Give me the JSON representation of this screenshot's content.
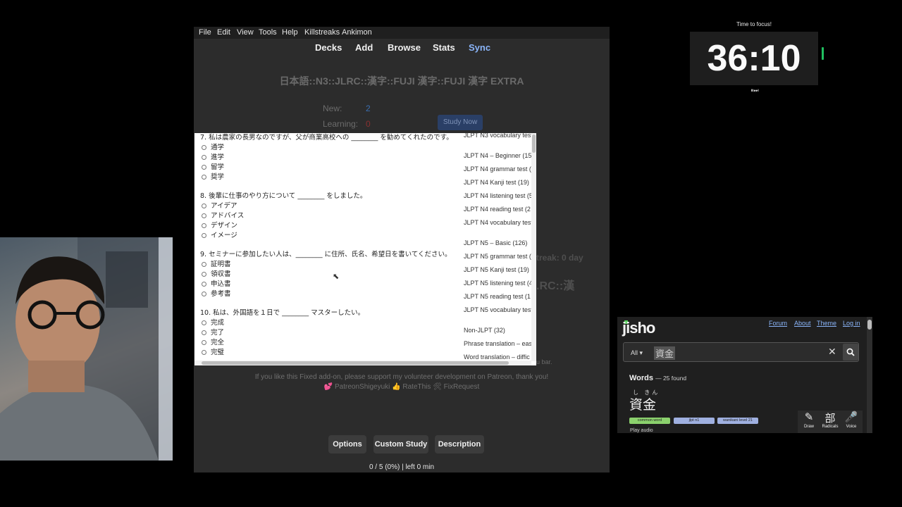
{
  "anki": {
    "menu": [
      "File",
      "Edit",
      "View",
      "Tools",
      "Help",
      "Killstreaks",
      "Ankimon"
    ],
    "toolbar": [
      "Decks",
      "Add",
      "Browse",
      "Stats",
      "Sync"
    ],
    "deck_title": "日本語::N3::JLRC::漢字::FUJI 漢字::FUJI 漢字 EXTRA",
    "stats": {
      "new_label": "New:",
      "new_value": "2",
      "learning_label": "Learning:",
      "learning_value": "0"
    },
    "study_now": "Study Now",
    "ghost_streak": "treak: 0 day",
    "ghost_deck": ".RC::漢",
    "ghost_bar": "u bar.",
    "support_line1": "If you like this Fixed add-on, please support my volunteer development on Patreon, thank you!",
    "support_line2": "💕 PatreonShigeyuki 👍 RateThis 🛠 FixRequest",
    "buttons": [
      "Options",
      "Custom Study",
      "Description"
    ],
    "progress": "0 / 5 (0%) | left 0 min"
  },
  "quiz": {
    "questions": [
      {
        "text": "7. 私は農家の長男なのですが、父が商業高校への ________ を勧めてくれたのです。",
        "options": [
          "通学",
          "進学",
          "留学",
          "奨学"
        ]
      },
      {
        "text": "8. 後輩に仕事のやり方について ________ をしました。",
        "options": [
          "アイデア",
          "アドバイス",
          "デザイン",
          "イメージ"
        ]
      },
      {
        "text": "9. セミナーに参加したい人は、________ に住所、氏名、希望日を書いてください。",
        "options": [
          "証明書",
          "領収書",
          "申込書",
          "参考書"
        ]
      },
      {
        "text": "10. 私は、外国語を１日で ________ マスターしたい。",
        "options": [
          "完成",
          "完了",
          "完全",
          "完璧"
        ]
      }
    ],
    "links": [
      "JLPT N3 vocabulary test",
      "JLPT N4 – Beginner (15",
      "JLPT N4 grammar test (",
      "JLPT N4 Kanji test (19)",
      "JLPT N4 listening test (5",
      "JLPT N4 reading test (2",
      "JLPT N4 vocabulary test",
      "JLPT N5 – Basic (126)",
      "JLPT N5 grammar test (",
      "JLPT N5 Kanji test (19)",
      "JLPT N5 listening test (4",
      "JLPT N5 reading test (1",
      "JLPT N5 vocabulary test",
      "Non-JLPT (32)",
      "Phrase translation – eas",
      "Word translation – diffic"
    ]
  },
  "timer": {
    "label": "Time to focus!",
    "value": "36:10",
    "controls": "⏸⏭"
  },
  "jisho": {
    "logo": "jisho",
    "nav": [
      "Forum",
      "About",
      "Theme",
      "Log in"
    ],
    "search_scope": "All ▾",
    "search_value": "資金",
    "words_label": "Words",
    "words_count": "— 25 found",
    "furigana": "し きん",
    "word": "資金",
    "tags": [
      "common word",
      "jlpt n1",
      "wanikani level 21"
    ],
    "play_audio": "Play audio",
    "tools": [
      {
        "icon": "✎",
        "label": "Draw"
      },
      {
        "icon": "部",
        "label": "Radicals"
      },
      {
        "icon": "🎤",
        "label": "Voice"
      }
    ]
  },
  "colors": {
    "sync": "#8ab4f8",
    "timer_accent": "#20c060",
    "jisho_green": "#56d15c",
    "tag_common": "#8bd16d",
    "tag_jlpt": "#9fb0e0",
    "tag_wanikani": "#9fb0e0"
  }
}
